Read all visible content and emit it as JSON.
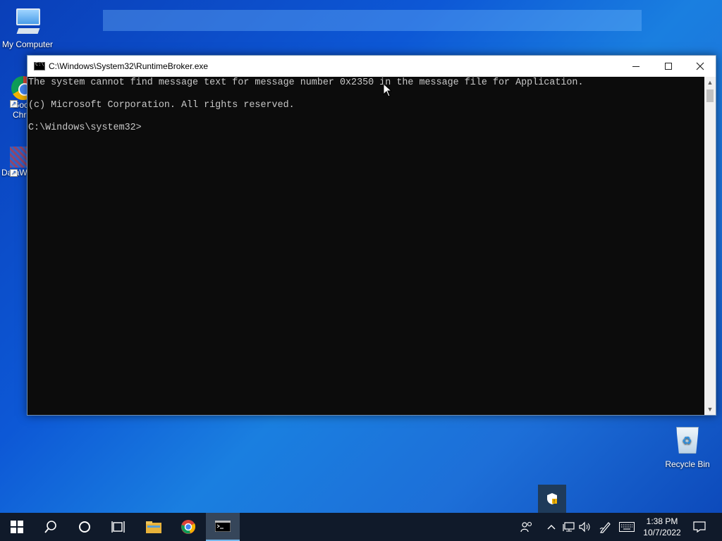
{
  "desktop": {
    "icons": {
      "my_computer": "My Computer",
      "chrome": "Goo\nChr",
      "dataw": "DataW",
      "recycle_bin": "Recycle Bin"
    }
  },
  "window": {
    "title": "C:\\Windows\\System32\\RuntimeBroker.exe",
    "console_lines": [
      "The system cannot find message text for message number 0x2350 in the message file for Application.",
      "(c) Microsoft Corporation. All rights reserved.",
      "C:\\Windows\\system32>"
    ]
  },
  "taskbar": {
    "clock_time": "1:38 PM",
    "clock_date": "10/7/2022",
    "pinned": [
      "start-icon",
      "search-icon",
      "cortana-icon",
      "task-view-icon",
      "file-explorer-icon",
      "chrome-icon",
      "terminal-icon"
    ]
  },
  "colors": {
    "console_bg": "#0c0c0c",
    "console_text": "#c8c8c8",
    "taskbar_bg": "#101a2a",
    "accent": "#76b9ed"
  }
}
